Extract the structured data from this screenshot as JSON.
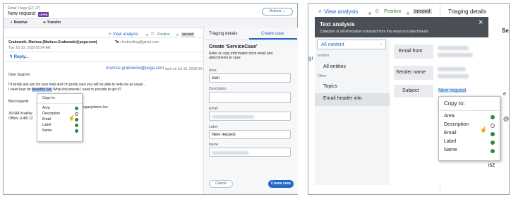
{
  "left": {
    "header": {
      "breadcrumb": "Email Triage (ET-17)",
      "title": "New request",
      "badge": "OPEN",
      "actions_label": "Actions ⌄"
    },
    "toolbar": {
      "resolve_label": "Resolve",
      "transfer_label": "Transfer"
    },
    "analysis_bar": {
      "view_label": "View analysis",
      "sentiment": "Positive",
      "highlight": "second"
    },
    "email": {
      "from": "Grabowski, Mariusz (Mariusz.Grabowski@pega.com)",
      "to_label": "To :",
      "to": "testmulling@gmail.com",
      "date": "Tue Jul 10, 2018 05:54 AM",
      "reply_label": "Reply...",
      "sent_from": "mariusz.grabowski@pega.com",
      "sent_on": "sent on Jul 10, 2018 05:54 AM",
      "greeting": "Dear Support,",
      "line1": "I'd kindly ask you for your help and I'm pretty sure you will be able to help me as usual...",
      "line2_pre": "I need loan for",
      "line2_hl": "beautiful car.",
      "line2_post": "What documents I need to provide to get it?",
      "regards": "Best regards",
      "company": "egasystems Inc.",
      "address": "30-644 Kraków",
      "office": "Office: (+48) 12"
    },
    "copy_menu": {
      "title": "Copy to:",
      "items": [
        "Area",
        "Description",
        "Email",
        "Label",
        "Name"
      ]
    },
    "tabs": {
      "tab1": "Triaging details",
      "tab2": "Create case"
    },
    "form": {
      "title": "Create 'ServiceCase'",
      "subtitle": "Enter or copy information from email and attachments to case",
      "area_label": "Area",
      "area_value": "loan",
      "description_label": "Description",
      "email_label": "Email",
      "label_label": "Label",
      "label_value": "New request",
      "name_label": "Name",
      "cancel": "Cancel",
      "create": "Create case"
    }
  },
  "right": {
    "analysis_bar": {
      "view_label": "View analysis",
      "sentiment": "Positive",
      "highlight": "second",
      "triaging": "Triaging details"
    },
    "overlay": {
      "title": "Text analysis",
      "subtitle": "Collection of all information extracted from this email and attachments",
      "close": "×"
    },
    "sidebar": {
      "dropdown": "All content",
      "entities_head": "Entities",
      "all_entities": "All entities",
      "other_head": "Other",
      "topics": "Topics",
      "email_header": "Email header info"
    },
    "rows": [
      {
        "label": "Email from"
      },
      {
        "label": "Sender name"
      },
      {
        "label": "Subject",
        "value": "New request"
      }
    ],
    "copy_menu": {
      "title": "Copy to:",
      "items": [
        "Area",
        "Description",
        "Email",
        "Label",
        "Name"
      ]
    },
    "edge_text": {
      "gr": "gr",
      "e": "e",
      "at": "@",
      "iusz": "iusz",
      "se": "Se"
    },
    "colors": {
      "overlay_bg": "#4a4f55",
      "accent": "#2268c5",
      "positive": "#2e8b3a",
      "badge": "#6a3fa0"
    }
  }
}
